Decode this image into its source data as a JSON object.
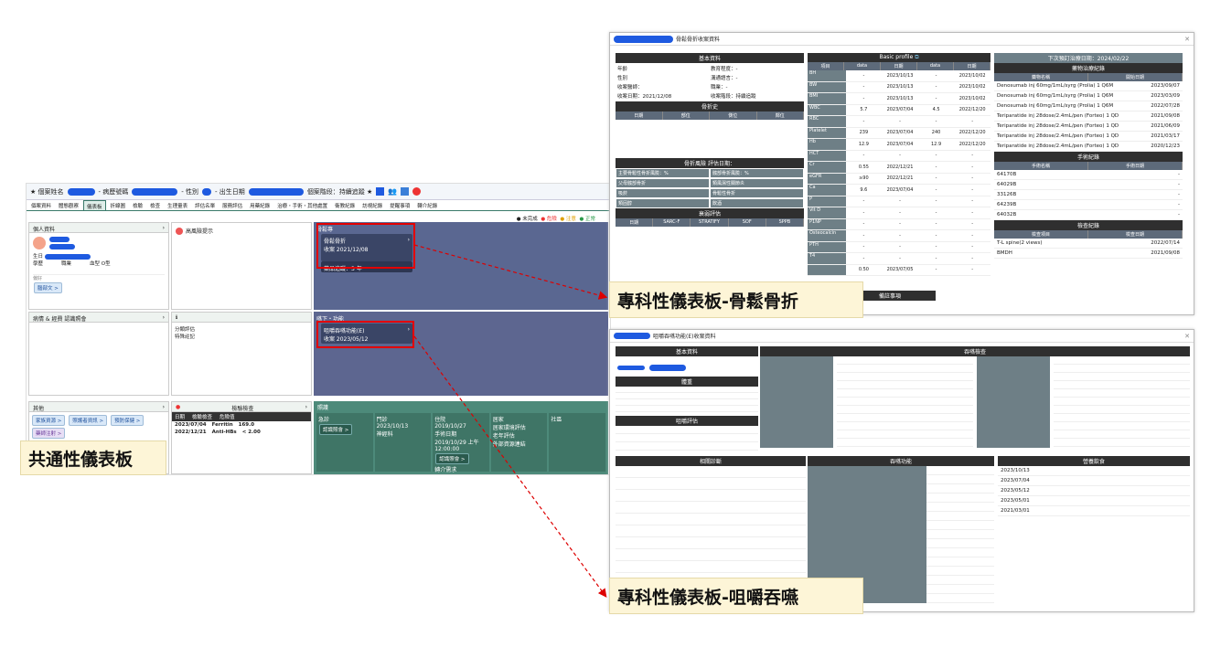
{
  "main": {
    "patient_name_label": "★ 個案姓名",
    "chart_no_label": "- 病歷號碼",
    "sex_label": "- 性別",
    "birth_label": "- 出生日期",
    "stage": "個案階段：持續追蹤 ★",
    "tabs": [
      "個案資料",
      "體態觀察",
      "儀表板",
      "折線圖",
      "檢驗",
      "檢查",
      "生理量表",
      "評估名單",
      "服務評估",
      "用藥紀錄",
      "治療・手術・其他處置",
      "衛教紀錄",
      "訪視紀錄",
      "提醒事項",
      "轉介紀錄"
    ],
    "legend": [
      "● 未完成",
      "● 危險",
      "● 注意",
      "● 正常"
    ],
    "personal_info_title": "個人資料",
    "birth_row": "生日",
    "school_row": "學歷",
    "job_row": "職業",
    "blood_type": "血型 O型",
    "pref_label": "偏好",
    "edit_chip": "腦部文 >",
    "high_risk_title": "高風險提示",
    "specialty_title": "骨鬆專",
    "osteo_card_title": "骨鬆骨折",
    "osteo_card_date": "收案 2021/12/08",
    "osteo_card_status": "藥品追蹤：3 年",
    "disease_title": "病情 & 經費 認識照會",
    "plan_title": "分類評估",
    "plan_line2": "特殊註記",
    "swallow_header": "嚥下・功能",
    "swallow_card_title": "咀嚼吞嚥功能(E)",
    "swallow_card_date": "收案 2023/05/12",
    "other_title": "其他",
    "other_chips": [
      "家族資源 >",
      "照護者資訊 >",
      "預防保健 >",
      "藥師注射 >"
    ],
    "lab_title": "檢驗檢查",
    "lab_cols": [
      "日期",
      "檢驗檢查",
      "危險值"
    ],
    "lab_rows": [
      [
        "2023/07/04",
        "Ferritin",
        "169.0"
      ],
      [
        "2022/12/21",
        "Anti-HBs",
        "< 2.00"
      ]
    ],
    "care_title": "照護",
    "care_cols": [
      "急診",
      "門診",
      "住院",
      "居家",
      "社區"
    ],
    "opd_date": "2023/10/13",
    "opd_dept": "神經科",
    "adm_line1": "2019/10/27",
    "adm_line2": "手術日期",
    "adm_line3": "2019/10/29 上午",
    "adm_line4": "12:00:00",
    "home_line1": "居家環境評估",
    "home_line2": "老年評估",
    "home_line3": "外部資源連結",
    "consult_btn": "認識照會 >",
    "consult_btn2": "認識照會 >",
    "consult_note": "轉介需求"
  },
  "labels": {
    "general": "共通性儀表板",
    "osteo": "專科性儀表板-骨鬆骨折",
    "swallow": "專科性儀表板-咀嚼吞嚥"
  },
  "osteo_win": {
    "title": "骨鬆骨折收案資料",
    "basic_title": "基本資料",
    "age": "年齡",
    "edu": "教育程度：-",
    "sex": "性別",
    "lang": "溝通語言：-",
    "doctor": "收案醫師：",
    "job": "職業：-",
    "date": "收案日期：2021/12/08",
    "stage": "收案階段：持續追蹤",
    "frac_title": "骨折史",
    "frac_cols": [
      "日期",
      "部位",
      "側位",
      "鄰位"
    ],
    "risk_title": "骨折風險 評估日期：",
    "risk_rows": [
      "主要骨鬆性骨折風險：%",
      "髖部骨折風險：%",
      "父母髖部骨折",
      "類風濕性關節炎",
      "吸菸",
      "骨鬆性骨折",
      "類固醇",
      "飲酒"
    ],
    "sarc_title": "衰弱評估",
    "sarc_cols": [
      "日期",
      "SARC-F",
      "STRATIFY",
      "SOF",
      "SPPB"
    ],
    "bp_title": "Basic profile",
    "bp_cols": [
      "項目",
      "data",
      "日期",
      "data",
      "日期"
    ],
    "bp_rows": [
      [
        "BH",
        "-",
        "2023/10/13",
        "-",
        "2023/10/02"
      ],
      [
        "BW",
        "-",
        "2023/10/13",
        "-",
        "2023/10/02"
      ],
      [
        "BMI",
        "-",
        "2023/10/13",
        "-",
        "2023/10/02"
      ],
      [
        "WBC",
        "5.7",
        "2023/07/04",
        "4.5",
        "2022/12/20"
      ],
      [
        "RBC",
        "-",
        "-",
        "-",
        "-"
      ],
      [
        "Platelet",
        "239",
        "2023/07/04",
        "240",
        "2022/12/20"
      ],
      [
        "Hb",
        "12.9",
        "2023/07/04",
        "12.9",
        "2022/12/20"
      ],
      [
        "HCT",
        "-",
        "-",
        "-",
        "-"
      ],
      [
        "Cr",
        "0.55",
        "2022/12/21",
        "-",
        "-"
      ],
      [
        "eGFR",
        "≥90",
        "2022/12/21",
        "-",
        "-"
      ],
      [
        "Ca",
        "9.6",
        "2023/07/04",
        "-",
        "-"
      ],
      [
        "P",
        "-",
        "-",
        "-",
        "-"
      ],
      [
        "Vit D",
        "-",
        "-",
        "-",
        "-"
      ],
      [
        "P1NP",
        "-",
        "-",
        "-",
        "-"
      ],
      [
        "Osteocalcin",
        "-",
        "-",
        "-",
        "-"
      ],
      [
        "PTH",
        "-",
        "-",
        "-",
        "-"
      ],
      [
        "T4",
        "-",
        "-",
        "-",
        "-"
      ],
      [
        "",
        "0.50",
        "2023/07/05",
        "-",
        "-"
      ]
    ],
    "note_title": "備註事項",
    "next_visit": "下次預訂治療日期：2024/02/22",
    "drug_title": "藥物治療紀錄",
    "drug_cols": [
      "藥物名稱",
      "開始日期"
    ],
    "drug_rows": [
      [
        "Denosumab inj 60mg/1mL/syrg (Prolia) 1 Q6M",
        "2023/09/07"
      ],
      [
        "Denosumab inj 60mg/1mL/syrg (Prolia) 1 Q6M",
        "2023/03/09"
      ],
      [
        "Denosumab inj 60mg/1mL/syrg (Prolia) 1 Q6M",
        "2022/07/28"
      ],
      [
        "Teriparatide inj 28dose/2.4mL/pen (Forteo) 1 QD",
        "2021/09/08"
      ],
      [
        "Teriparatide inj 28dose/2.4mL/pen (Forteo) 1 QD",
        "2021/06/09"
      ],
      [
        "Teriparatide inj 28dose/2.4mL/pen (Forteo) 1 QD",
        "2021/03/17"
      ],
      [
        "Teriparatide inj 28dose/2.4mL/pen (Forteo) 1 QD",
        "2020/12/23"
      ]
    ],
    "surg_title": "手術紀錄",
    "surg_cols": [
      "手術名稱",
      "手術日期"
    ],
    "surg_rows": [
      [
        "64170B",
        "-"
      ],
      [
        "64029B",
        "-"
      ],
      [
        "33126B",
        "-"
      ],
      [
        "64239B",
        "-"
      ],
      [
        "64032B",
        "-"
      ]
    ],
    "exam_title": "檢查紀錄",
    "exam_cols": [
      "檢查項目",
      "檢查日期"
    ],
    "exam_rows": [
      [
        "T-L spine(2 views)",
        "2022/07/14"
      ],
      [
        "BMDH",
        "2021/09/08"
      ]
    ]
  },
  "swallow_win": {
    "title": "咀嚼吞嚥功能(E)收案資料",
    "basic_title": "基本資料",
    "bp_title": "吞嚥檢查",
    "body_title": "體重",
    "eval_title": "咀嚼評估",
    "hist_title": "相關診斷",
    "swallow_eval": "吞嚥功能",
    "team_title": "營養飲食",
    "dates": [
      "2023/10/13",
      "2023/07/04",
      "2023/05/12",
      "2023/05/01",
      "2021/03/01"
    ]
  }
}
